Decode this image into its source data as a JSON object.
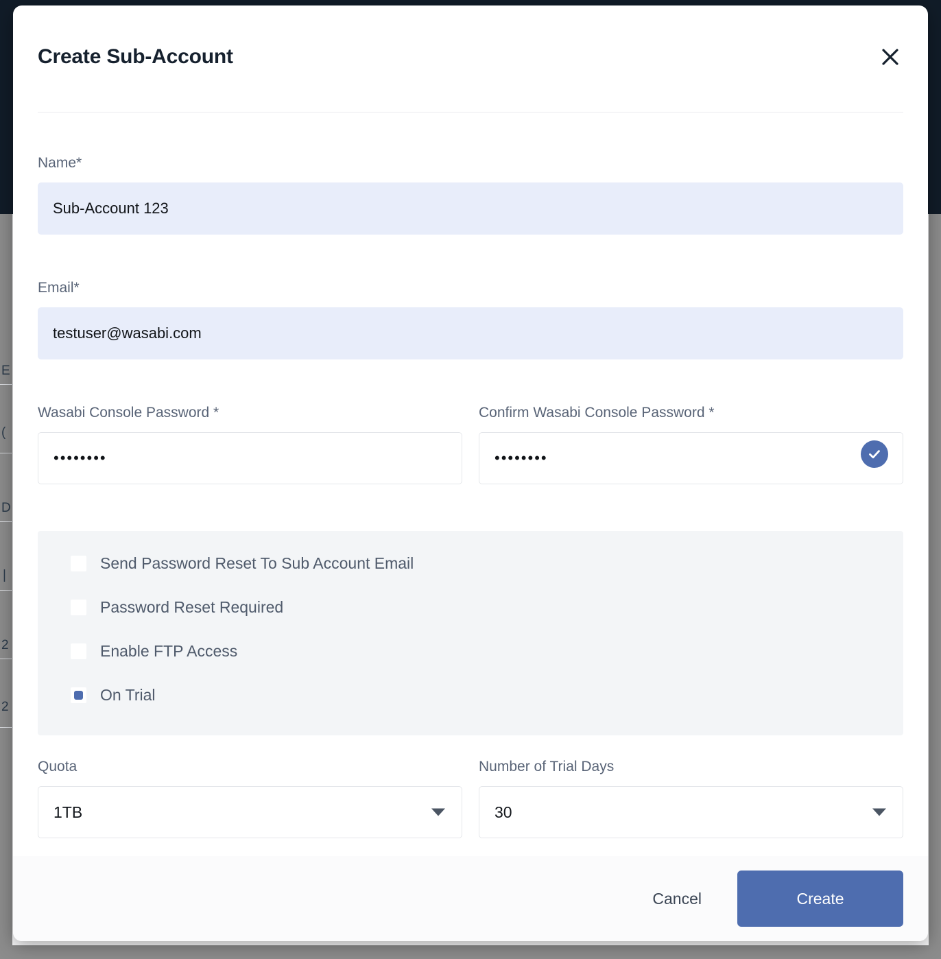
{
  "dialog": {
    "title": "Create Sub-Account",
    "close_icon": "close-icon"
  },
  "fields": {
    "name": {
      "label": "Name*",
      "value": "Sub-Account 123",
      "placeholder": "Name"
    },
    "email": {
      "label": "Email*",
      "value": "testuser@wasabi.com",
      "placeholder": "Email"
    },
    "password": {
      "label": "Wasabi Console Password *",
      "value": "••••••••",
      "placeholder": "Password"
    },
    "confirm_password": {
      "label": "Confirm Wasabi Console Password *",
      "value": "••••••••",
      "placeholder": "Confirm Password",
      "valid_icon": "check-circle-icon"
    }
  },
  "options": [
    {
      "label": "Send Password Reset To Sub Account Email",
      "checked": false
    },
    {
      "label": "Password Reset Required",
      "checked": false
    },
    {
      "label": "Enable FTP Access",
      "checked": false
    },
    {
      "label": "On Trial",
      "checked": true
    }
  ],
  "selects": {
    "quota": {
      "label": "Quota",
      "value": "1TB",
      "caret_icon": "chevron-down-icon"
    },
    "trial_days": {
      "label": "Number of Trial Days",
      "value": "30",
      "caret_icon": "chevron-down-icon"
    }
  },
  "footer": {
    "cancel_label": "Cancel",
    "create_label": "Create"
  },
  "colors": {
    "accent_blue": "#4e6daf",
    "autofill_blue": "#e8edfa",
    "panel_grey": "#f3f5f7",
    "title_navy": "#16212e",
    "label_grey": "#596477",
    "backdrop_grey": "#8c8c8c",
    "topbar_navy": "#111c28"
  }
}
